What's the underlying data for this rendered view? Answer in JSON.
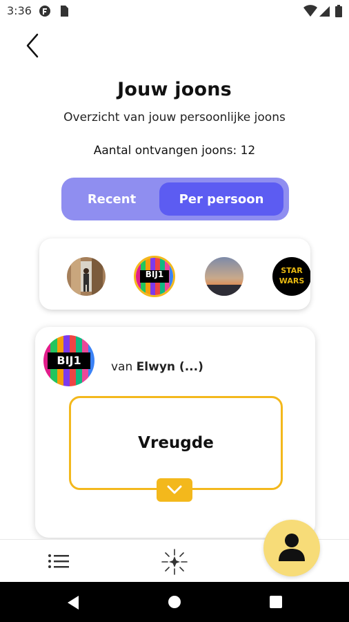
{
  "status_bar": {
    "time": "3:36"
  },
  "header": {
    "title": "Jouw joons",
    "subtitle": "Overzicht van jouw persoonlijke joons",
    "count_text": "Aantal ontvangen joons: 12"
  },
  "tabs": {
    "recent": "Recent",
    "per_person": "Per persoon",
    "selected": "Per persoon"
  },
  "avatars": [
    {
      "name": "photo-person-avatar",
      "badge": ""
    },
    {
      "name": "bij1-avatar",
      "badge": "BIJ1"
    },
    {
      "name": "sunset-avatar",
      "badge": ""
    },
    {
      "name": "star-wars-avatar",
      "badge": "STAR WARS"
    }
  ],
  "card": {
    "avatar_badge": "BIJ1",
    "from_prefix": "van",
    "from_name": "Elwyn (...)",
    "emotion": "Vreugde"
  },
  "colors": {
    "accent_dark": "#5c5cf2",
    "accent_light": "#8f8ef0",
    "yellow": "#f3b81c",
    "fab": "#f7dc78"
  }
}
